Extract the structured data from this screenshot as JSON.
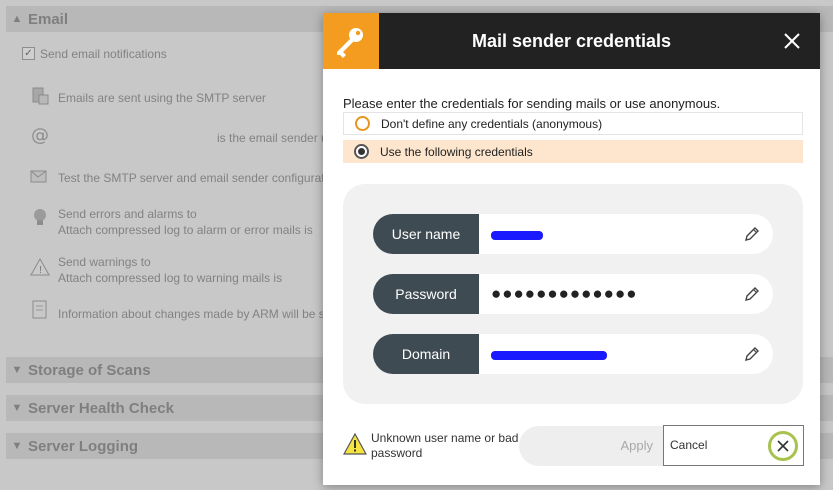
{
  "background": {
    "sections": {
      "email": "Email",
      "storage": "Storage of Scans",
      "health": "Server Health Check",
      "logging": "Server Logging"
    },
    "send_email_label": "Send email notifications",
    "lines": {
      "smtp": "Emails are sent using the SMTP server",
      "sender": "is the email sender u",
      "test": "Test the SMTP server and email sender configurati",
      "errors_1": "Send errors and alarms to",
      "errors_2": "Attach compressed log to alarm or error mails is",
      "warnings_1": "Send warnings to",
      "warnings_2": "Attach compressed log to warning mails is",
      "info": "Information about changes made by ARM will be s"
    }
  },
  "dialog": {
    "title": "Mail sender credentials",
    "prompt": "Please enter the credentials for sending mails or use anonymous.",
    "options": [
      {
        "label": "Don't define any credentials (anonymous)",
        "selected": false
      },
      {
        "label": "Use the following credentials",
        "selected": true
      }
    ],
    "fields": {
      "username": {
        "label": "User name"
      },
      "password": {
        "label": "Password",
        "value": "●●●●●●●●●●●●●"
      },
      "domain": {
        "label": "Domain"
      }
    },
    "warning": "Unknown user name or bad password",
    "apply_label": "Apply",
    "cancel_label": "Cancel"
  },
  "colors": {
    "accent": "#f39c1f",
    "header": "#222222",
    "field_label": "#3f4b52",
    "selected_row": "#fde6cd",
    "cancel_ring": "#a8c24e"
  }
}
